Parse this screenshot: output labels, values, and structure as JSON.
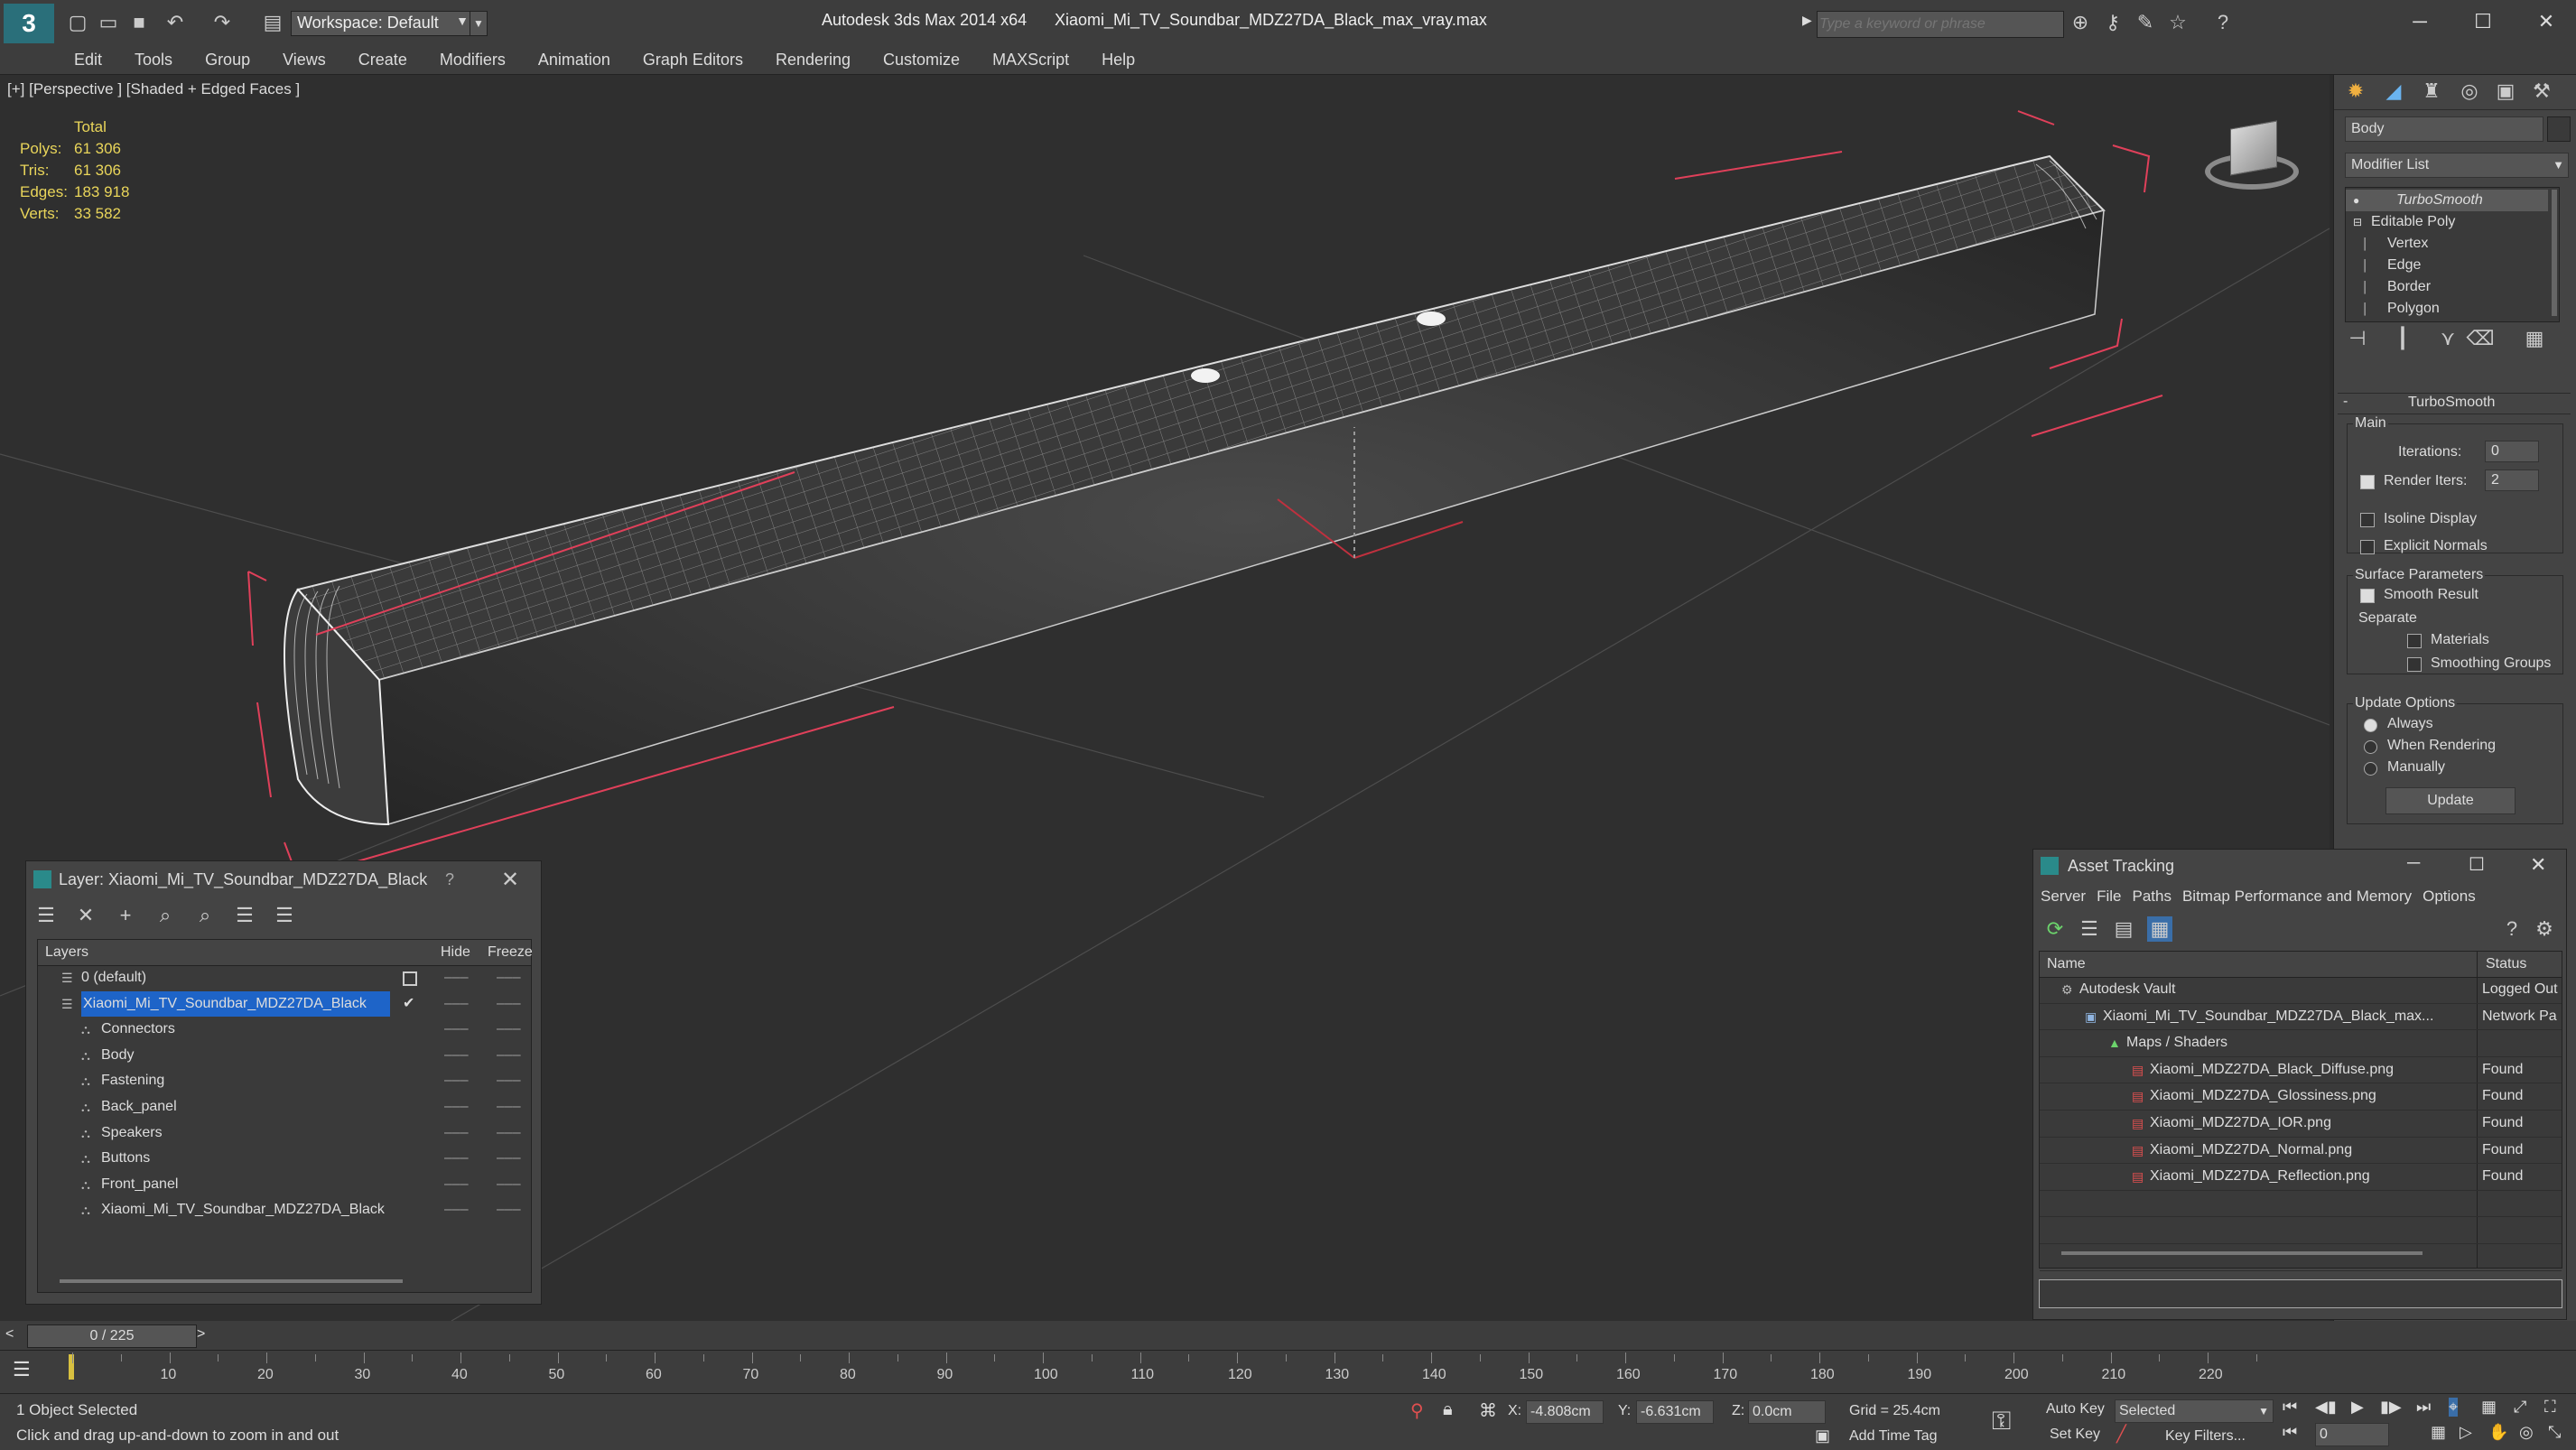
{
  "titlebar": {
    "workspace": "Workspace: Default",
    "app_title": "Autodesk 3ds Max  2014 x64",
    "file_title": "Xiaomi_Mi_TV_Soundbar_MDZ27DA_Black_max_vray.max",
    "search_placeholder": "Type a keyword or phrase"
  },
  "menu": [
    "Edit",
    "Tools",
    "Group",
    "Views",
    "Create",
    "Modifiers",
    "Animation",
    "Graph Editors",
    "Rendering",
    "Customize",
    "MAXScript",
    "Help"
  ],
  "viewport": {
    "label": "[+] [Perspective ] [Shaded + Edged Faces ]",
    "stats": {
      "header": "Total",
      "rows": [
        {
          "label": "Polys:",
          "value": "61 306"
        },
        {
          "label": "Tris:",
          "value": "61 306"
        },
        {
          "label": "Edges:",
          "value": "183 918"
        },
        {
          "label": "Verts:",
          "value": "33 582"
        }
      ]
    }
  },
  "command_panel": {
    "object_name": "Body",
    "modifier_list": "Modifier List",
    "stack": [
      {
        "label": "TurboSmooth",
        "level": 0
      },
      {
        "label": "Editable Poly",
        "level": 0
      },
      {
        "label": "Vertex",
        "level": 1
      },
      {
        "label": "Edge",
        "level": 1
      },
      {
        "label": "Border",
        "level": 1
      },
      {
        "label": "Polygon",
        "level": 1
      }
    ],
    "rollout_title": "TurboSmooth",
    "main_label": "Main",
    "iterations_label": "Iterations:",
    "iterations_value": "0",
    "render_iters_label": "Render Iters:",
    "render_iters_value": "2",
    "isoline_label": "Isoline Display",
    "explicit_normals_label": "Explicit Normals",
    "surface_params_label": "Surface Parameters",
    "smooth_result_label": "Smooth Result",
    "separate_label": "Separate",
    "materials_label": "Materials",
    "smoothing_groups_label": "Smoothing Groups",
    "update_options_label": "Update Options",
    "always_label": "Always",
    "when_rendering_label": "When Rendering",
    "manually_label": "Manually",
    "update_button": "Update"
  },
  "layer_dialog": {
    "title": "Layer: Xiaomi_Mi_TV_Soundbar_MDZ27DA_Black",
    "help": "?",
    "col_layers": "Layers",
    "col_hide": "Hide",
    "col_freeze": "Freeze",
    "rows": [
      {
        "name": "0 (default)",
        "indent": 1,
        "selected": false
      },
      {
        "name": "Xiaomi_Mi_TV_Soundbar_MDZ27DA_Black",
        "indent": 1,
        "selected": true
      },
      {
        "name": "Connectors",
        "indent": 2,
        "selected": false
      },
      {
        "name": "Body",
        "indent": 2,
        "selected": false
      },
      {
        "name": "Fastening",
        "indent": 2,
        "selected": false
      },
      {
        "name": "Back_panel",
        "indent": 2,
        "selected": false
      },
      {
        "name": "Speakers",
        "indent": 2,
        "selected": false
      },
      {
        "name": "Buttons",
        "indent": 2,
        "selected": false
      },
      {
        "name": "Front_panel",
        "indent": 2,
        "selected": false
      },
      {
        "name": "Xiaomi_Mi_TV_Soundbar_MDZ27DA_Black",
        "indent": 2,
        "selected": false
      }
    ]
  },
  "asset_dialog": {
    "title": "Asset Tracking",
    "menu": [
      "Server",
      "File",
      "Paths",
      "Bitmap Performance and Memory",
      "Options"
    ],
    "col_name": "Name",
    "col_status": "Status",
    "rows": [
      {
        "name": "Autodesk Vault",
        "status": "Logged Out",
        "indent": 1,
        "icon": "vault"
      },
      {
        "name": "Xiaomi_Mi_TV_Soundbar_MDZ27DA_Black_max...",
        "status": "Network Pa",
        "indent": 2,
        "icon": "max"
      },
      {
        "name": "Maps / Shaders",
        "status": "",
        "indent": 3,
        "icon": "maps"
      },
      {
        "name": "Xiaomi_MDZ27DA_Black_Diffuse.png",
        "status": "Found",
        "indent": 4,
        "icon": "png"
      },
      {
        "name": "Xiaomi_MDZ27DA_Glossiness.png",
        "status": "Found",
        "indent": 4,
        "icon": "png"
      },
      {
        "name": "Xiaomi_MDZ27DA_IOR.png",
        "status": "Found",
        "indent": 4,
        "icon": "png"
      },
      {
        "name": "Xiaomi_MDZ27DA_Normal.png",
        "status": "Found",
        "indent": 4,
        "icon": "png"
      },
      {
        "name": "Xiaomi_MDZ27DA_Reflection.png",
        "status": "Found",
        "indent": 4,
        "icon": "png"
      }
    ]
  },
  "timeline": {
    "frame": "0 / 225",
    "ticks": [
      "10",
      "20",
      "30",
      "40",
      "50",
      "60",
      "70",
      "80",
      "90",
      "100",
      "110",
      "120",
      "130",
      "140",
      "150",
      "160",
      "170",
      "180",
      "190",
      "200",
      "210",
      "220"
    ]
  },
  "status": {
    "selection": "1 Object Selected",
    "prompt": "Click and drag up-and-down to zoom in and out",
    "x_label": "X:",
    "x_value": "-4.808cm",
    "y_label": "Y:",
    "y_value": "-6.631cm",
    "z_label": "Z:",
    "z_value": "0.0cm",
    "grid": "Grid = 25.4cm",
    "auto_key": "Auto Key",
    "set_key": "Set Key",
    "key_mode": "Selected",
    "key_filters": "Key Filters...",
    "add_time_tag": "Add Time Tag",
    "current_frame": "0"
  },
  "colors": {
    "stat_text": "#e9d55a",
    "layer_selected": "#1e64c8",
    "bbox_red": "#e0405a"
  }
}
